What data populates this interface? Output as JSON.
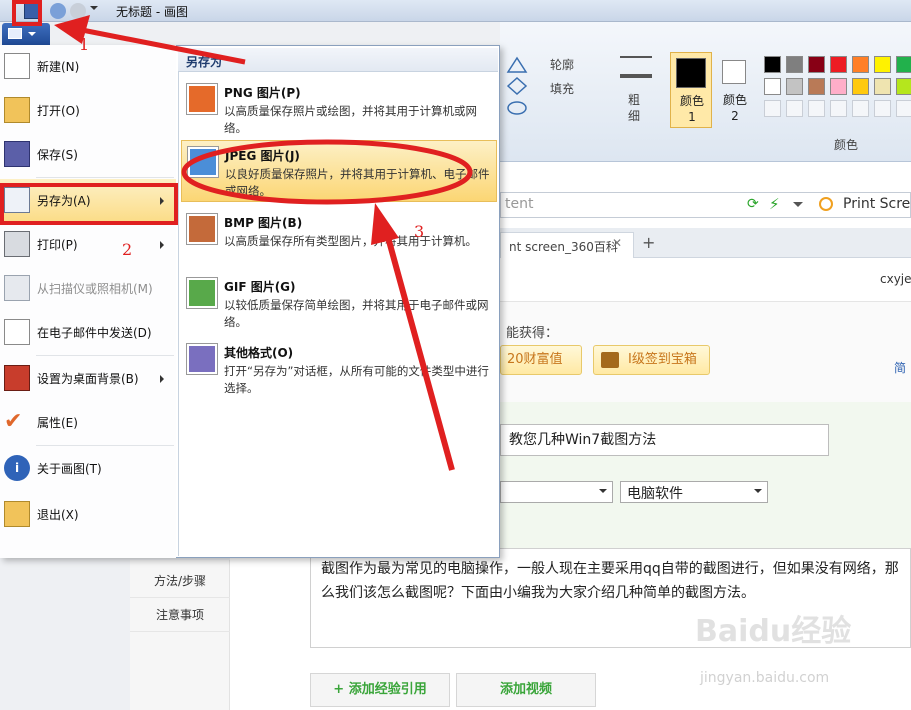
{
  "window": {
    "title": "无标题 - 画图"
  },
  "ribbon": {
    "outline_label": "轮廓",
    "fill_label": "填充",
    "size_label": "粗细",
    "color1_label": "颜色 1",
    "color2_label": "颜色 2",
    "colors_group_label": "颜色",
    "palette": [
      "#000000",
      "#7f7f7f",
      "#880015",
      "#ed1c24",
      "#ff7f27",
      "#fff200",
      "#22b14c",
      "#00a2e8",
      "#ffffff",
      "#c3c3c3",
      "#b97a57",
      "#ffaec9",
      "#ffc90e",
      "#efe4b0",
      "#b5e61d",
      "#99d9ea"
    ]
  },
  "browser": {
    "address_fragment": "tent",
    "search_text": "Print Scre",
    "tab_label": "nt screen_360百科",
    "tab_new": "+",
    "username": "cxyjee",
    "earn_text": "能获得：",
    "wealth_button": "20财富值",
    "badge_button": "I级签到宝箱",
    "simplified_link": "简",
    "title_value": "教您几种Win7截图方法",
    "category_select": "电脑软件",
    "description": "截图作为最为常见的电脑操作，一般人现在主要采用qq自带的截图进行，但如果没有网络，那么我们该怎么截图呢？下面由小编我为大家介绍几种简单的截图方法。",
    "nav_items": [
      "方法/步骤",
      "注意事项"
    ],
    "add_reference": "+ 添加经验引用",
    "add_video": "添加视频",
    "watermark": "Baidu经验",
    "watermark_url": "jingyan.baidu.com"
  },
  "menu": {
    "items": [
      {
        "label": "新建(N)",
        "icon": "new-file-icon",
        "disabled": false
      },
      {
        "label": "打开(O)",
        "icon": "open-folder-icon",
        "disabled": false
      },
      {
        "label": "保存(S)",
        "icon": "save-disk-icon",
        "disabled": false
      },
      {
        "label": "另存为(A)",
        "icon": "save-as-icon",
        "disabled": false,
        "submenu": true
      },
      {
        "label": "打印(P)",
        "icon": "printer-icon",
        "disabled": false,
        "submenu": true
      },
      {
        "label": "从扫描仪或照相机(M)",
        "icon": "scanner-icon",
        "disabled": true
      },
      {
        "label": "在电子邮件中发送(D)",
        "icon": "email-icon",
        "disabled": false
      },
      {
        "label": "设置为桌面背景(B)",
        "icon": "desktop-icon",
        "disabled": false,
        "submenu": true
      },
      {
        "label": "属性(E)",
        "icon": "checkmark-icon",
        "disabled": false
      },
      {
        "label": "关于画图(T)",
        "icon": "info-icon",
        "disabled": false
      },
      {
        "label": "退出(X)",
        "icon": "exit-icon",
        "disabled": false
      }
    ],
    "saveas_header": "另存为",
    "saveas_options": [
      {
        "title": "PNG 图片(P)",
        "desc": "以高质量保存照片或绘图，并将其用于计算机或网络。",
        "icon": "png-icon"
      },
      {
        "title": "JPEG 图片(J)",
        "desc": "以良好质量保存照片，并将其用于计算机、电子邮件或网络。",
        "icon": "jpeg-icon"
      },
      {
        "title": "BMP 图片(B)",
        "desc": "以高质量保存所有类型图片，并将其用于计算机。",
        "icon": "bmp-icon"
      },
      {
        "title": "GIF 图片(G)",
        "desc": "以较低质量保存简单绘图，并将其用于电子邮件或网络。",
        "icon": "gif-icon"
      },
      {
        "title": "其他格式(O)",
        "desc": "打开“另存为”对话框，从所有可能的文件类型中进行选择。",
        "icon": "other-format-icon"
      }
    ]
  },
  "annotations": {
    "step1": "1",
    "step2": "2",
    "step3": "3",
    "accent": "#e02020"
  }
}
